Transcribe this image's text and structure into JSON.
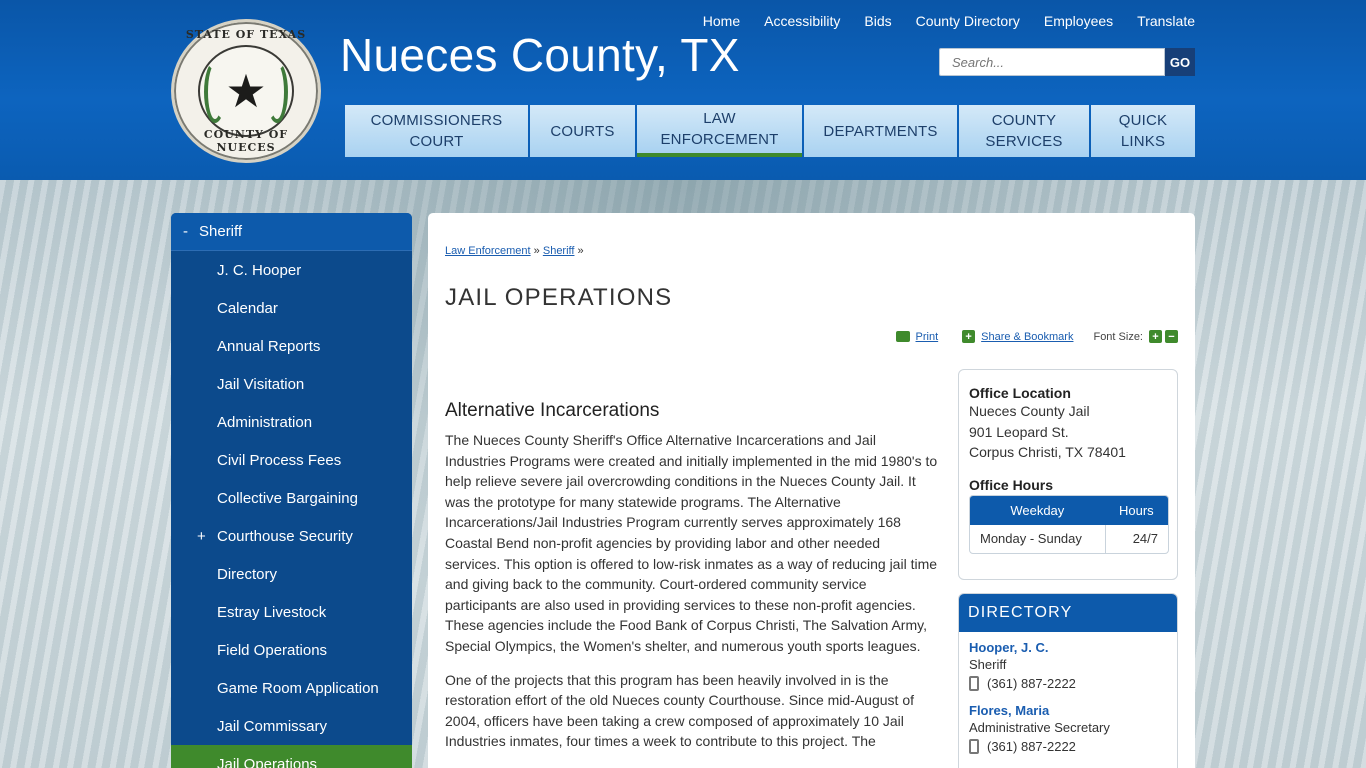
{
  "header": {
    "site_title": "Nueces County, TX",
    "seal_text_top": "STATE OF TEXAS",
    "seal_text_bottom": "COUNTY OF NUECES",
    "top_links": [
      "Home",
      "Accessibility",
      "Bids",
      "County Directory",
      "Employees",
      "Translate"
    ],
    "search_placeholder": "Search...",
    "search_button": "GO"
  },
  "main_nav": [
    {
      "label": "COMMISSIONERS COURT",
      "active": false
    },
    {
      "label": "COURTS",
      "active": false
    },
    {
      "label": "LAW ENFORCEMENT",
      "active": true
    },
    {
      "label": "DEPARTMENTS",
      "active": false
    },
    {
      "label": "COUNTY SERVICES",
      "active": false
    },
    {
      "label": "QUICK LINKS",
      "active": false
    }
  ],
  "sidebar": {
    "header": {
      "toggle": "-",
      "label": "Sheriff"
    },
    "items": [
      {
        "label": "J. C. Hooper"
      },
      {
        "label": "Calendar"
      },
      {
        "label": "Annual Reports"
      },
      {
        "label": "Jail Visitation"
      },
      {
        "label": "Administration"
      },
      {
        "label": "Civil Process Fees"
      },
      {
        "label": "Collective Bargaining"
      },
      {
        "label": "Courthouse Security",
        "toggle": "+"
      },
      {
        "label": "Directory"
      },
      {
        "label": "Estray Livestock"
      },
      {
        "label": "Field Operations"
      },
      {
        "label": "Game Room Application"
      },
      {
        "label": "Jail Commissary"
      },
      {
        "label": "Jail Operations",
        "current": true
      }
    ]
  },
  "content": {
    "breadcrumb": {
      "items": [
        "Law Enforcement",
        "Sheriff"
      ],
      "separator": "»"
    },
    "page_title": "JAIL OPERATIONS",
    "tools": {
      "print": "Print",
      "share": "Share & Bookmark",
      "font_size": "Font Size:"
    },
    "article": {
      "heading": "Alternative Incarcerations",
      "paragraphs": [
        "The Nueces County Sheriff's Office Alternative Incarcerations and Jail Industries Programs were created and initially implemented in the mid 1980's to help relieve severe jail overcrowding conditions in the Nueces County Jail. It was the prototype for many statewide programs. The Alternative Incarcerations/Jail Industries Program currently serves approximately 168 Coastal Bend non-profit agencies by providing labor and other needed services. This option is offered to low-risk inmates as a way of reducing jail time and giving back to the community. Court-ordered community service participants are also used in providing services to these non-profit agencies. These agencies include the Food Bank of Corpus Christi, The Salvation Army, Special Olympics, the Women's shelter, and numerous youth sports leagues.",
        "One of the projects that this program has been heavily involved in is the restoration effort of the old Nueces county Courthouse. Since mid-August of 2004, officers have been taking a crew composed of approximately 10 Jail Industries inmates, four times a week to contribute to this project. The"
      ]
    }
  },
  "office": {
    "location_title": "Office Location",
    "location_lines": [
      "Nueces County Jail",
      "901 Leopard St.",
      "Corpus Christi, TX 78401"
    ],
    "hours_title": "Office Hours",
    "hours_columns": [
      "Weekday",
      "Hours"
    ],
    "hours_rows": [
      [
        "Monday - Sunday",
        "24/7"
      ]
    ]
  },
  "directory": {
    "title": "DIRECTORY",
    "entries": [
      {
        "name": "Hooper, J. C.",
        "role": "Sheriff",
        "phone": "(361) 887-2222"
      },
      {
        "name": "Flores, Maria",
        "role": "Administrative Secretary",
        "phone": "(361) 887-2222"
      }
    ]
  },
  "colors": {
    "header_blue": "#0d64bf",
    "nav_light_blue": "#a9d2f1",
    "sidebar_blue": "#0c4a8c",
    "active_green": "#3f8a2c",
    "link_blue": "#1a5db0"
  }
}
